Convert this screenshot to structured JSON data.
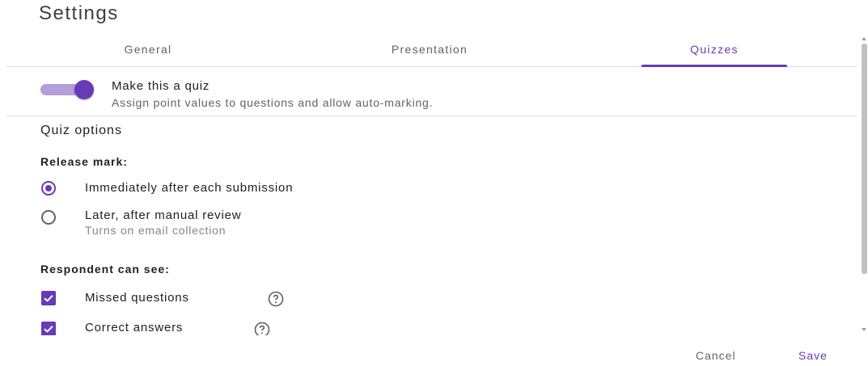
{
  "dialog": {
    "title": "Settings"
  },
  "tabs": [
    {
      "label": "General"
    },
    {
      "label": "Presentation"
    },
    {
      "label": "Quizzes",
      "selected": true
    }
  ],
  "quiz_toggle": {
    "label": "Make this a quiz",
    "description": "Assign point values to questions and allow auto-marking.",
    "enabled": true
  },
  "quiz_options": {
    "title": "Quiz options",
    "release_mark": {
      "heading": "Release mark:",
      "options": [
        {
          "label": "Immediately after each submission",
          "selected": true
        },
        {
          "label": "Later, after manual review",
          "sublabel": "Turns on email collection",
          "selected": false
        }
      ]
    },
    "respondent_can_see": {
      "heading": "Respondent can see:",
      "items": [
        {
          "label": "Missed questions",
          "checked": true,
          "help_icon": "help-circle-icon"
        },
        {
          "label": "Correct answers",
          "checked": true,
          "help_icon": "help-circle-icon"
        }
      ]
    }
  },
  "footer": {
    "cancel_label": "Cancel",
    "save_label": "Save"
  },
  "colors": {
    "accent": "#673ab7",
    "accent_light": "#b39ddb",
    "text": "#202124",
    "secondary_text": "#5f6368"
  }
}
